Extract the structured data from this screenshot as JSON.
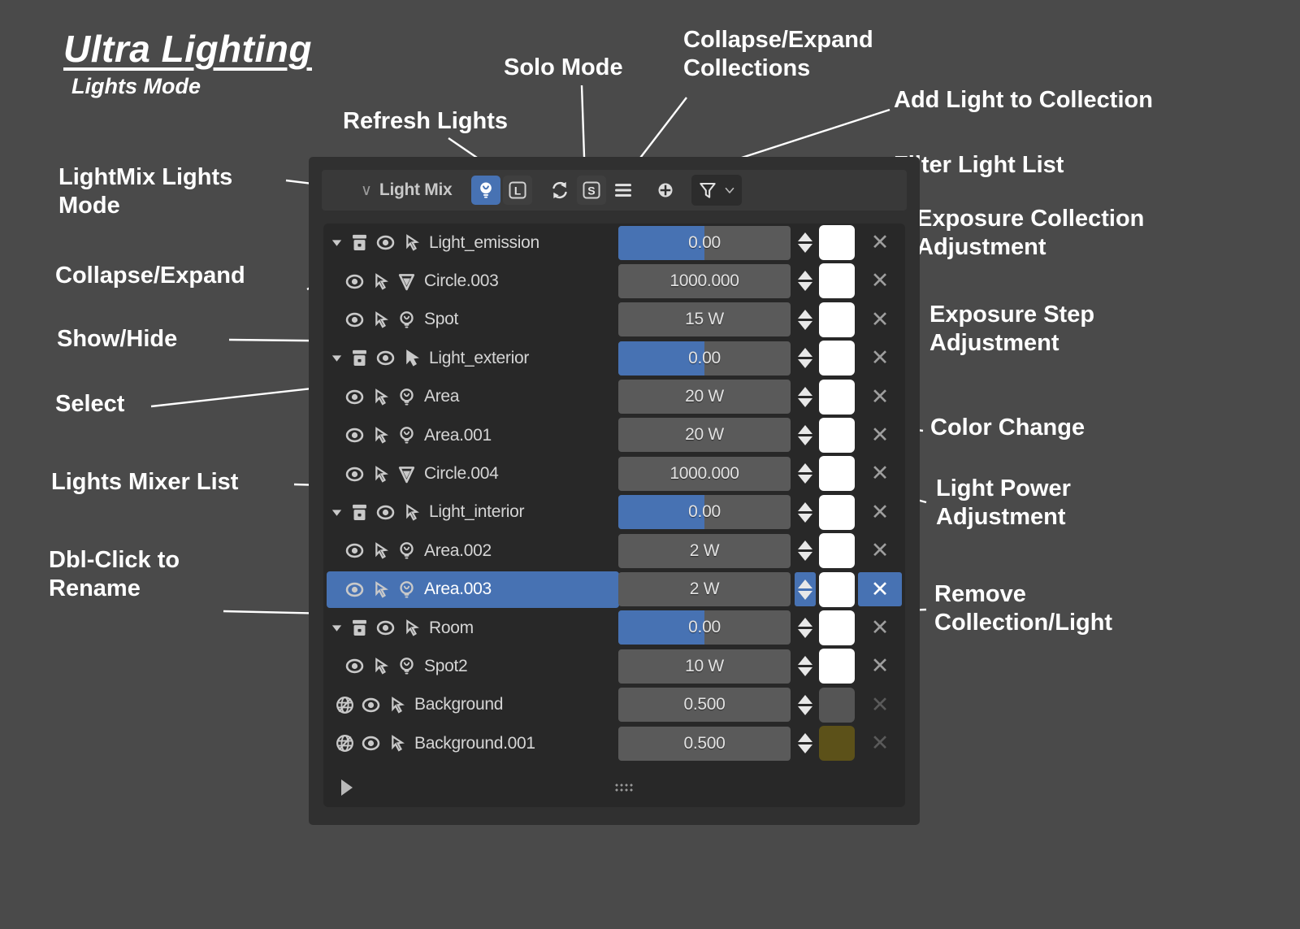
{
  "title": {
    "main": "Ultra Lighting",
    "sub": "Lights Mode"
  },
  "colors": {
    "accent_blue": "#4772b3",
    "panel_bg": "#303030",
    "list_bg": "#282828",
    "slider_bg": "#5a5a5a",
    "page_bg": "#4a4a4a",
    "text": "#d5d5d5",
    "background_swatch_1": "#555555",
    "background_swatch_2": "#5c5119"
  },
  "annotations": [
    {
      "name": "refresh-lights",
      "text": "Refresh Lights"
    },
    {
      "name": "solo-mode",
      "text": "Solo Mode"
    },
    {
      "name": "collapse-expand-collections",
      "text": "Collapse/Expand\nCollections"
    },
    {
      "name": "add-light-to-collection",
      "text": "Add Light to Collection"
    },
    {
      "name": "filter-light-list",
      "text": "Filter Light List"
    },
    {
      "name": "lightmix-lights-mode",
      "text": "LightMix Lights\nMode"
    },
    {
      "name": "collapse-expand",
      "text": "Collapse/Expand"
    },
    {
      "name": "show-hide",
      "text": "Show/Hide"
    },
    {
      "name": "select",
      "text": "Select"
    },
    {
      "name": "lights-mixer-list",
      "text": "Lights Mixer List"
    },
    {
      "name": "dbl-click-to-rename",
      "text": "Dbl-Click to\nRename"
    },
    {
      "name": "exposure-collection-adjustment",
      "text": "Exposure Collection\nAdjustment"
    },
    {
      "name": "exposure-step-adjustment",
      "text": "Exposure Step\nAdjustment"
    },
    {
      "name": "color-change",
      "text": "Color Change"
    },
    {
      "name": "light-power-adjustment",
      "text": "Light Power\nAdjustment"
    },
    {
      "name": "remove-collection-light",
      "text": "Remove\nCollection/Light"
    }
  ],
  "panel": {
    "header": {
      "chevron": "∨",
      "title": "Light Mix",
      "buttons": [
        {
          "name": "lightmix-lights-mode-button",
          "icon": "bulb-icon",
          "label": "",
          "active": true
        },
        {
          "name": "lightmix-layers-mode-button",
          "icon": "letter-l-icon",
          "label": "L",
          "active": false
        },
        {
          "name": "refresh-lights-button",
          "icon": "refresh-icon",
          "label": "",
          "active": false
        },
        {
          "name": "solo-mode-button",
          "icon": "letter-s-icon",
          "label": "S",
          "active": false
        },
        {
          "name": "collapse-expand-collections-button",
          "icon": "hamburger-icon",
          "label": "",
          "active": false
        },
        {
          "name": "add-light-button",
          "icon": "plus-circle-icon",
          "label": "",
          "active": false
        },
        {
          "name": "filter-button",
          "icon": "funnel-icon",
          "label": "",
          "active": false
        },
        {
          "name": "filter-dropdown-button",
          "icon": "chevron-down-icon",
          "label": "",
          "active": false
        }
      ]
    },
    "rows": [
      {
        "name": "Light_emission",
        "type": "collection",
        "value": "0.00",
        "fill": 50,
        "swatch": "#ffffff",
        "selected": false,
        "select_filled": false,
        "removable": true
      },
      {
        "name": "Circle.003",
        "type": "mesh",
        "value": "1000.000",
        "fill": 0,
        "swatch": "#ffffff",
        "selected": false,
        "select_filled": false,
        "removable": true
      },
      {
        "name": "Spot",
        "type": "lamp",
        "value": "15 W",
        "fill": 0,
        "swatch": "#ffffff",
        "selected": false,
        "select_filled": false,
        "removable": true
      },
      {
        "name": "Light_exterior",
        "type": "collection",
        "value": "0.00",
        "fill": 50,
        "swatch": "#ffffff",
        "selected": false,
        "select_filled": true,
        "removable": true
      },
      {
        "name": "Area",
        "type": "lamp",
        "value": "20 W",
        "fill": 0,
        "swatch": "#ffffff",
        "selected": false,
        "select_filled": false,
        "removable": true
      },
      {
        "name": "Area.001",
        "type": "lamp",
        "value": "20 W",
        "fill": 0,
        "swatch": "#ffffff",
        "selected": false,
        "select_filled": false,
        "removable": true
      },
      {
        "name": "Circle.004",
        "type": "mesh",
        "value": "1000.000",
        "fill": 0,
        "swatch": "#ffffff",
        "selected": false,
        "select_filled": false,
        "removable": true
      },
      {
        "name": "Light_interior",
        "type": "collection",
        "value": "0.00",
        "fill": 50,
        "swatch": "#ffffff",
        "selected": false,
        "select_filled": false,
        "removable": true
      },
      {
        "name": "Area.002",
        "type": "lamp",
        "value": "2 W",
        "fill": 0,
        "swatch": "#ffffff",
        "selected": false,
        "select_filled": false,
        "removable": true
      },
      {
        "name": "Area.003",
        "type": "lamp",
        "value": "2 W",
        "fill": 0,
        "swatch": "#ffffff",
        "selected": true,
        "select_filled": false,
        "removable": true
      },
      {
        "name": "Room",
        "type": "collection",
        "value": "0.00",
        "fill": 50,
        "swatch": "#ffffff",
        "selected": false,
        "select_filled": false,
        "removable": true
      },
      {
        "name": "Spot2",
        "type": "lamp",
        "value": "10 W",
        "fill": 0,
        "swatch": "#ffffff",
        "selected": false,
        "select_filled": false,
        "removable": true
      },
      {
        "name": "Background",
        "type": "world",
        "value": "0.500",
        "fill": 0,
        "swatch": "#555555",
        "selected": false,
        "select_filled": false,
        "removable": false
      },
      {
        "name": "Background.001",
        "type": "world",
        "value": "0.500",
        "fill": 0,
        "swatch": "#5c5119",
        "selected": false,
        "select_filled": false,
        "removable": false
      }
    ],
    "remove_glyph": "✕"
  }
}
